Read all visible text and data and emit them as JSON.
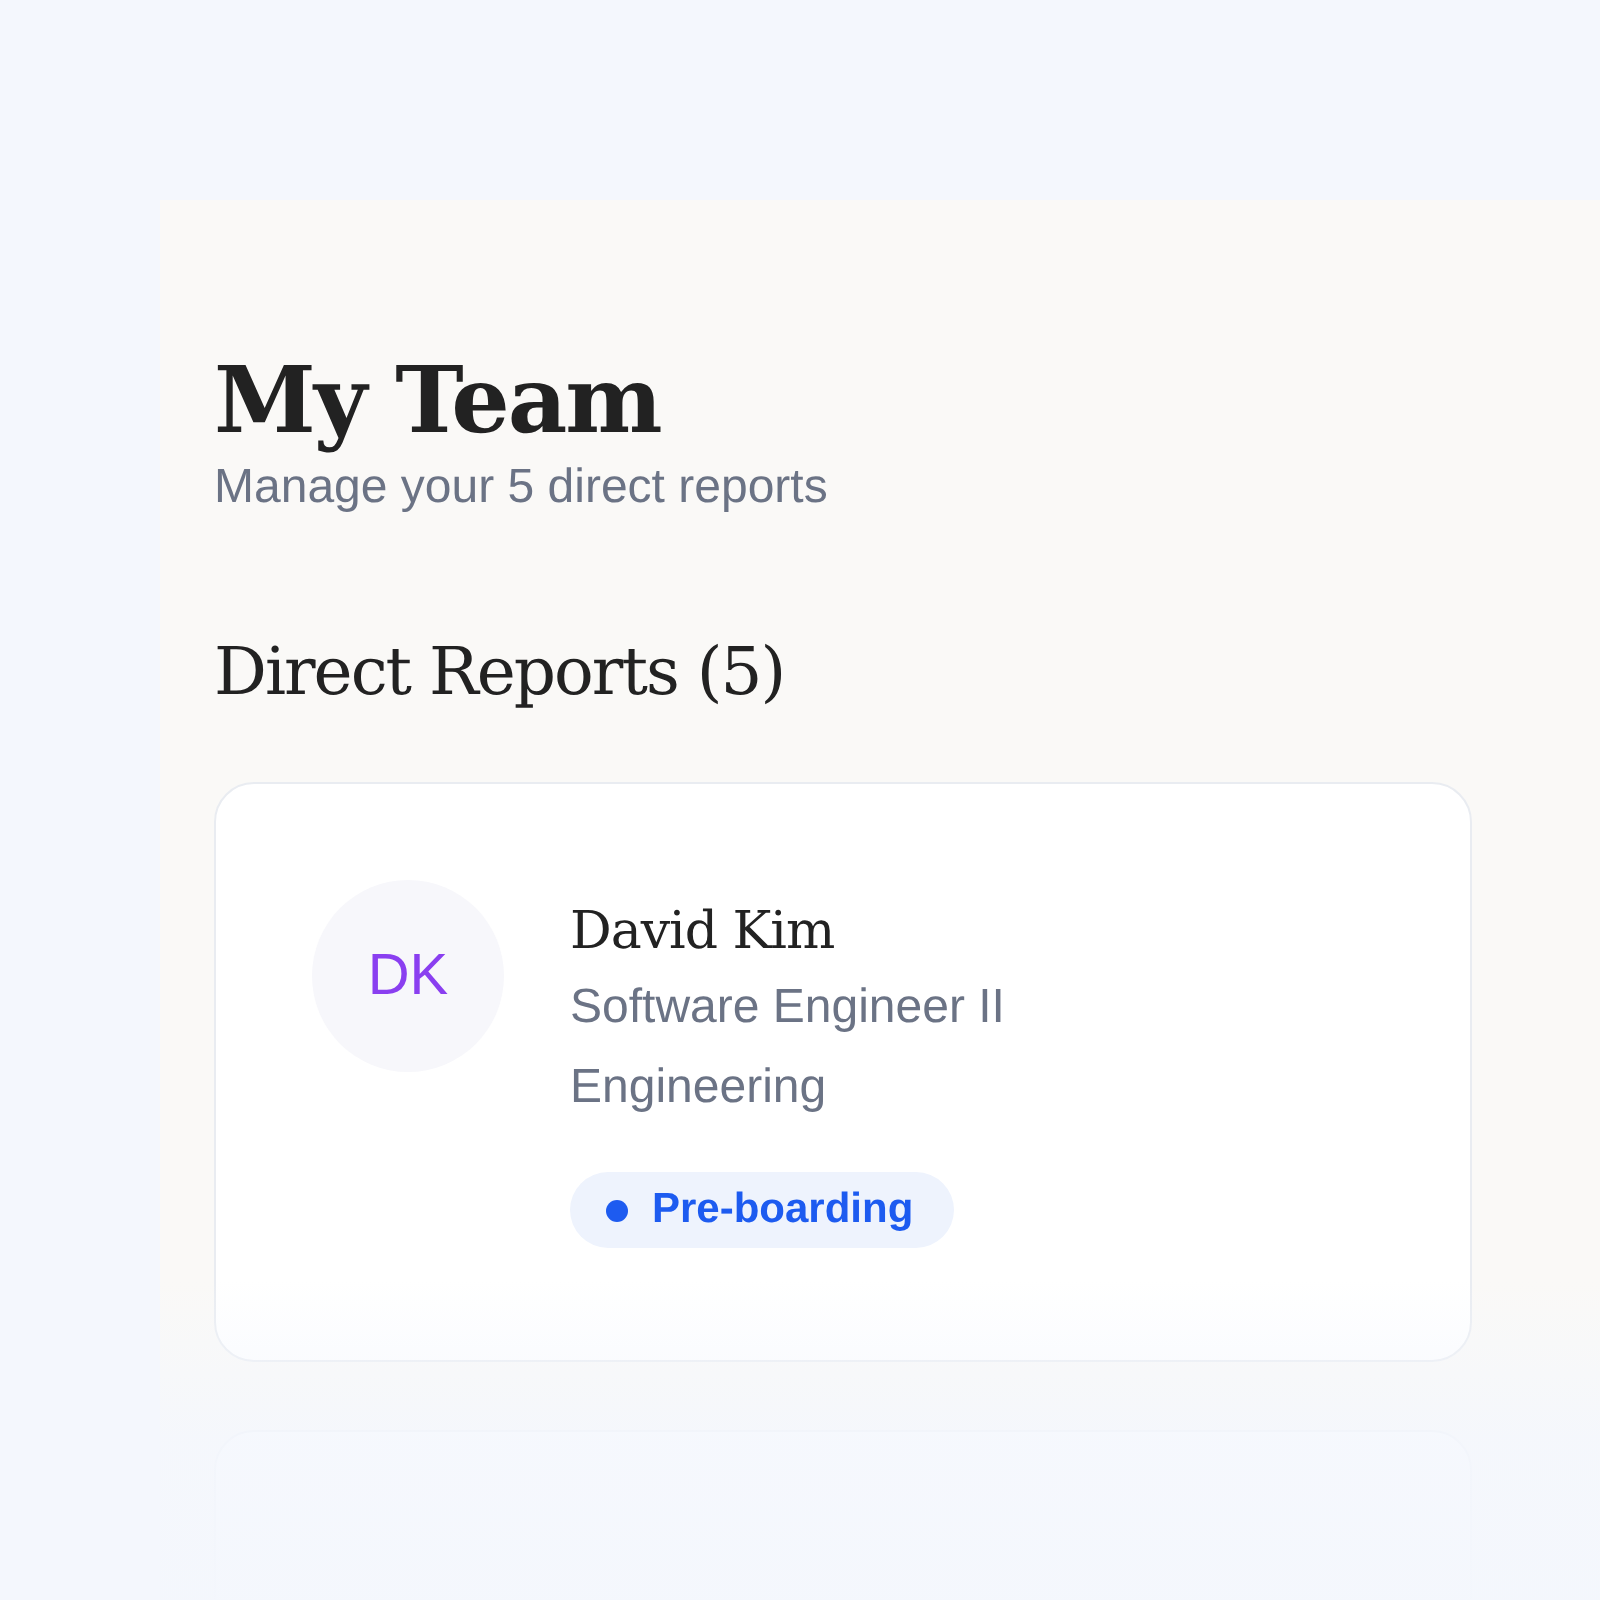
{
  "page": {
    "title": "My Team",
    "subtitle": "Manage your 5 direct reports"
  },
  "section": {
    "title": "Direct Reports (5)"
  },
  "reports": [
    {
      "initials": "DK",
      "name": "David Kim",
      "role": "Software Engineer II",
      "department": "Engineering",
      "status": {
        "label": "Pre-boarding",
        "kind": "preboarding"
      }
    }
  ]
}
